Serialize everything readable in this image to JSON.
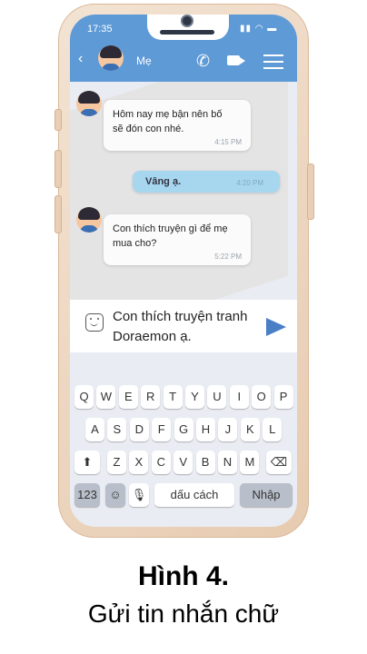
{
  "status_bar": {
    "time": "17:35",
    "signal_icons": "▮▮ ◠ ▬"
  },
  "header": {
    "contact_name": "Mẹ",
    "back_icon": "‹",
    "phone_icon": "✆"
  },
  "messages": [
    {
      "text_line1": "Hôm nay mẹ bận nên bố",
      "text_line2": "sẽ đón con nhé.",
      "time": "4:15 PM"
    },
    {
      "text": "Vâng ạ.",
      "time": "4:20 PM"
    },
    {
      "text_line1": "Con thích truyện gì để mẹ",
      "text_line2": "mua cho?",
      "time": "5:22 PM"
    }
  ],
  "input": {
    "line1": "Con thích truyện tranh",
    "line2": "Doraemon ạ."
  },
  "keyboard": {
    "row1": [
      "Q",
      "W",
      "E",
      "R",
      "T",
      "Y",
      "U",
      "I",
      "O",
      "P"
    ],
    "row2": [
      "A",
      "S",
      "D",
      "F",
      "G",
      "H",
      "J",
      "K",
      "L"
    ],
    "row3": [
      "Z",
      "X",
      "C",
      "V",
      "B",
      "N",
      "M"
    ],
    "shift": "⬆",
    "backspace": "⌫",
    "numbers": "123",
    "emoji": "☺",
    "mic": "🎙",
    "space": "dấu cách",
    "enter": "Nhập"
  },
  "caption": {
    "title": "Hình 4.",
    "subtitle": "Gửi tin nhắn chữ"
  }
}
